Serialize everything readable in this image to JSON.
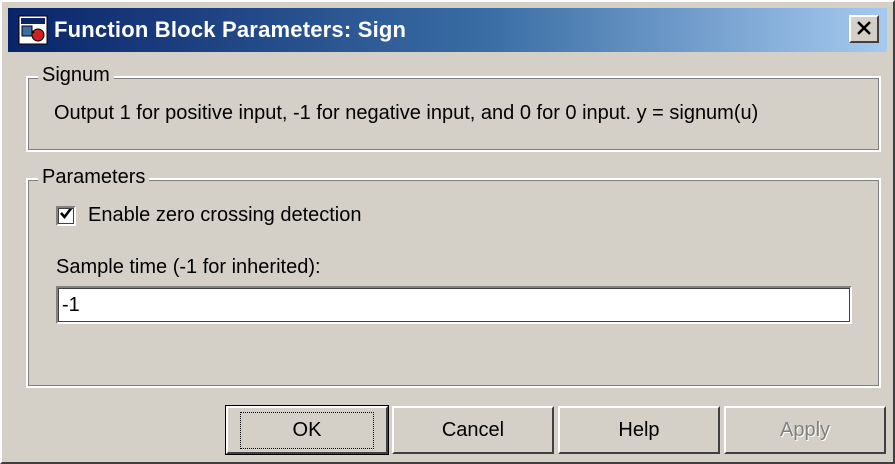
{
  "window": {
    "title": "Function Block Parameters: Sign",
    "close_glyph": "✕"
  },
  "signum_group": {
    "legend": "Signum",
    "description": "Output 1 for positive input, -1 for negative input, and 0 for 0 input.  y = signum(u)"
  },
  "parameters_group": {
    "legend": "Parameters",
    "zero_crossing": {
      "label": "Enable zero crossing detection",
      "checked": true
    },
    "sample_time": {
      "label": "Sample time (-1 for inherited):",
      "value": "-1"
    }
  },
  "buttons": {
    "ok": "OK",
    "cancel": "Cancel",
    "help": "Help",
    "apply": "Apply"
  },
  "colors": {
    "title_gradient_start": "#0a246a",
    "title_gradient_end": "#a6caf0",
    "dialog_face": "#d4d0c8"
  },
  "icons": {
    "app": "simulink-block-icon",
    "checkmark": "checkmark-icon",
    "close": "close-icon"
  }
}
